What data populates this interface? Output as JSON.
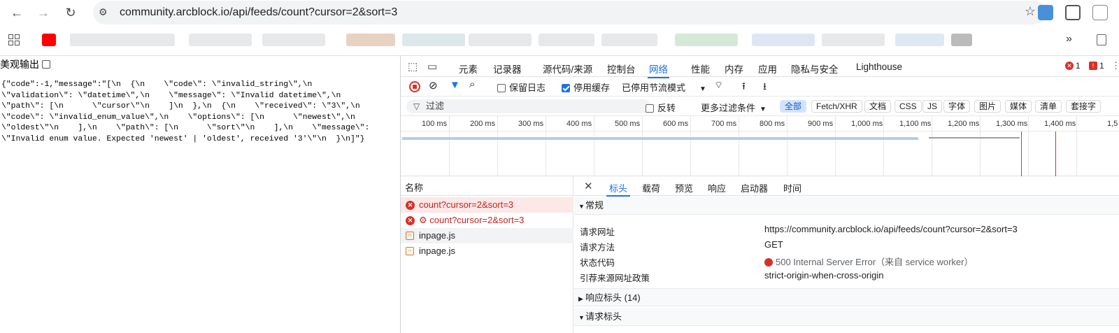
{
  "browser": {
    "url": "community.arcblock.io/api/feeds/count?cursor=2&sort=3",
    "overflow_label": "»"
  },
  "left_pane": {
    "pretty_print_label": "美观输出",
    "json_lines": [
      "{\"code\":-1,\"message\":\"[\\n  {\\n    \\\"code\\\": \\\"invalid_string\\\",\\n",
      "\\\"validation\\\": \\\"datetime\\\",\\n    \\\"message\\\": \\\"Invalid datetime\\\",\\n",
      "\\\"path\\\": [\\n      \\\"cursor\\\"\\n    ]\\n  },\\n  {\\n    \\\"received\\\": \\\"3\\\",\\n",
      "\\\"code\\\": \\\"invalid_enum_value\\\",\\n    \\\"options\\\": [\\n      \\\"newest\\\",\\n",
      "\\\"oldest\\\"\\n    ],\\n    \\\"path\\\": [\\n      \\\"sort\\\"\\n    ],\\n    \\\"message\\\":",
      "\\\"Invalid enum value. Expected 'newest' | 'oldest', received '3'\\\"\\n  }\\n]\"}"
    ]
  },
  "devtools": {
    "tabs": [
      "元素",
      "记录器",
      "源代码/来源",
      "控制台",
      "网络",
      "性能",
      "内存",
      "应用",
      "隐私与安全",
      "Lighthouse"
    ],
    "active_tab": "网络",
    "error_count": "1",
    "issue_count": "1",
    "toolbar": {
      "preserve_log": "保留日志",
      "disable_cache": "停用缓存",
      "throttle": "已停用节流模式"
    },
    "filter": {
      "placeholder": "过滤",
      "invert": "反转",
      "more_filters": "更多过滤条件",
      "types": [
        "全部",
        "Fetch/XHR",
        "文档",
        "CSS",
        "JS",
        "字体",
        "图片",
        "媒体",
        "清单",
        "套接字"
      ]
    },
    "timeline_ticks": [
      "100 ms",
      "200 ms",
      "300 ms",
      "400 ms",
      "500 ms",
      "600 ms",
      "700 ms",
      "800 ms",
      "900 ms",
      "1,000 ms",
      "1,100 ms",
      "1,200 ms",
      "1,300 ms",
      "1,400 ms",
      "1,5"
    ],
    "request_list": {
      "header": "名称",
      "rows": [
        {
          "name": "count?cursor=2&sort=3",
          "status": "error",
          "selected": true
        },
        {
          "name": "⚙ count?cursor=2&sort=3",
          "status": "error",
          "selected": false
        },
        {
          "name": "inpage.js",
          "status": "js",
          "selected": false
        },
        {
          "name": "inpage.js",
          "status": "js",
          "selected": false
        }
      ]
    },
    "detail": {
      "tabs": [
        "标头",
        "载荷",
        "预览",
        "响应",
        "启动器",
        "时间"
      ],
      "active_tab": "标头",
      "general_title": "常规",
      "general": [
        {
          "key": "请求网址",
          "value": "https://community.arcblock.io/api/feeds/count?cursor=2&sort=3"
        },
        {
          "key": "请求方法",
          "value": "GET"
        },
        {
          "key": "状态代码",
          "value": "500 Internal Server Error（来自 service worker）"
        },
        {
          "key": "引荐来源网址政策",
          "value": "strict-origin-when-cross-origin"
        }
      ],
      "response_headers": "响应标头 (14)",
      "request_headers": "请求标头"
    }
  },
  "colors": {
    "accent": "#1a73e8",
    "error": "#d93025"
  }
}
